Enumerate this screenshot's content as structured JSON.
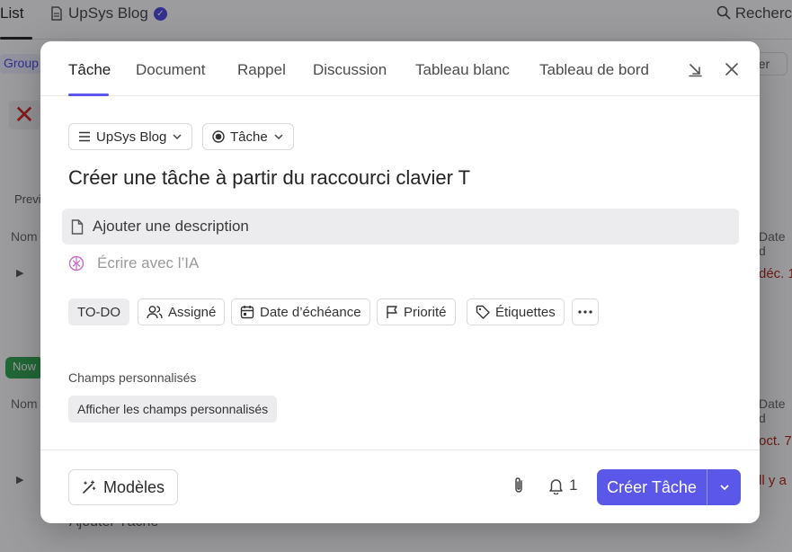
{
  "background": {
    "tab_list": "List",
    "blog_tab": "UpSys Blog",
    "search": "Recherc",
    "group": "Group",
    "right_button": "rer",
    "prev": "Previ",
    "nom": "Nom",
    "date_col": "Date d",
    "red_texts": [
      "déc. 1",
      "oct. 7",
      "ll y a"
    ],
    "now_badge": "Now",
    "add_task": "Ajouter Tâche"
  },
  "modal": {
    "tabs": [
      {
        "label": "Tâche"
      },
      {
        "label": "Document"
      },
      {
        "label": "Rappel"
      },
      {
        "label": "Discussion"
      },
      {
        "label": "Tableau blanc"
      },
      {
        "label": "Tableau de bord"
      }
    ],
    "list_selector": "UpSys Blog",
    "type_selector": "Tâche",
    "task_title": "Créer une tâche à partir du raccourci clavier T",
    "description_placeholder": "Ajouter une description",
    "ai_write": "Écrire avec l’IA",
    "properties": {
      "status": "TO-DO",
      "assignee": "Assigné",
      "due_date": "Date d’échéance",
      "priority": "Priorité",
      "tags": "Étiquettes"
    },
    "custom_fields_label": "Champs personnalisés",
    "custom_fields_button": "Afficher les champs personnalisés",
    "footer": {
      "templates": "Modèles",
      "reminder_count": "1",
      "create_button": "Créer Tâche"
    }
  },
  "colors": {
    "accent": "#5b57e8",
    "overlay": "rgba(20,20,24,0.42)",
    "ai_icon": "#c869c9"
  }
}
